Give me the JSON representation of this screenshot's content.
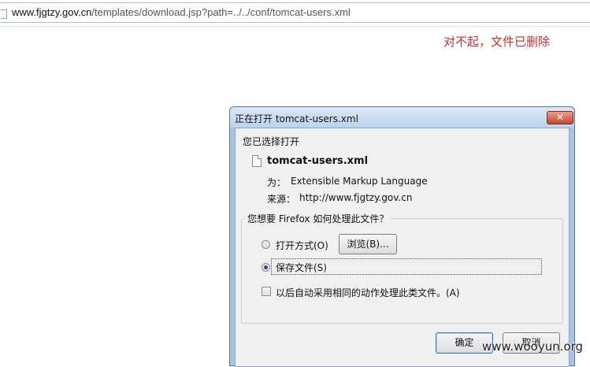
{
  "browser": {
    "url_host": "www.fjgtzy.gov.cn",
    "url_path": "/templates/download.jsp?path=../../conf/tomcat-users.xml"
  },
  "page": {
    "message": "对不起，文件已删除",
    "message_color": "#c8302a"
  },
  "dialog": {
    "title": "正在打开 tomcat-users.xml",
    "close_label": "✕",
    "selected_label": "您已选择打开",
    "file_name": "tomcat-users.xml",
    "type_label": "为：",
    "type_value": "Extensible Markup Language",
    "source_label": "来源：",
    "source_value": "http://www.fjgtzy.gov.cn",
    "question": "您想要 Firefox 如何处理此文件？",
    "open_with_label": "打开方式(O)",
    "browse_label": "浏览(B)...",
    "save_file_label": "保存文件(S)",
    "remember_label": "以后自动采用相同的动作处理此类文件。(A)",
    "ok_label": "确定",
    "cancel_label": "取消",
    "selected_option": "save_file"
  },
  "watermark": "www.wooyun.org"
}
